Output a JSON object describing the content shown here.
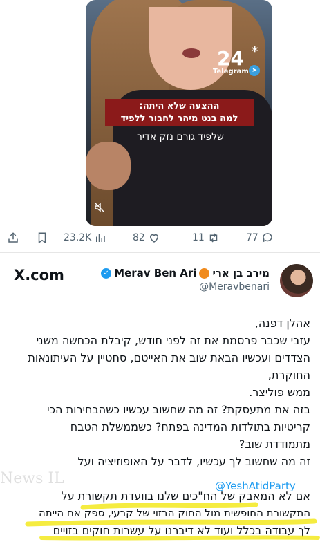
{
  "video": {
    "logo_number": "24",
    "logo_star": "*",
    "logo_sub": "Telegram",
    "banner_line1": "ההצעה שלא היתה:",
    "banner_line2": "למה בנט מיהר לחבור ללפיד",
    "caption": "שלפיד גורם נזק אדיר"
  },
  "tweet_actions": {
    "views": "23.2K",
    "likes": "82",
    "retweets": "11",
    "replies": "77"
  },
  "source_label": "X.com",
  "author": {
    "display_name": "Merav Ben Ari",
    "hebrew_name": "מירב בן ארי",
    "handle": "@Meravbenari"
  },
  "tweet_lines": [
    "אהלן דפנה,",
    "עזבי שכבר פרסמת את זה לפני חודש, קיבלת הכחשה משני",
    "הצדדים ועכשיו הבאת שוב את האייטם, סחטיין על העיתונאות",
    "החוקרת,",
    "ממש פוליצר.",
    "בזה את מתעסקת? זה מה שחשוב עכשיו כשהבחירות הכי",
    "קריטיות בתולדות המדינה בפתח? כשממשלת הטבח",
    "מתמודדת שוב?",
    "זה מה שחשוב לך עכשיו, לדבר על האופוזיציה ועל",
    "",
    "אם לא המאבק של הח\"כים שלנו בוועדת תקשורת על",
    "התקשורת החופשית מול החוק הבזוי של קרעי, ספק אם הייתה",
    "לך עבודה בכלל ועוד לא דיברנו על עשרות חוקים בזויים"
  ],
  "mention": "@YeshAtidParty",
  "watermark": "News IL",
  "colors": {
    "accent": "#1d9bf0",
    "banner": "#8b1a1a",
    "highlight": "#f2e600"
  }
}
